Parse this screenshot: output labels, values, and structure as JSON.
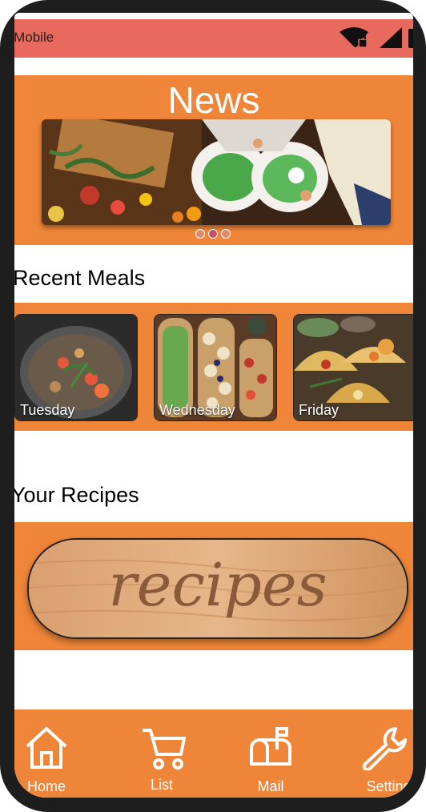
{
  "status_bar": {
    "carrier": "T-Mobile",
    "wifi_icon": "wifi-lock-icon",
    "signal_icon": "signal-icon"
  },
  "news": {
    "title": "News",
    "carousel_image": "salad-preparation-photo",
    "slide_count": 3,
    "active_slide": 2
  },
  "recent_meals": {
    "title": "Recent Meals",
    "items": [
      {
        "label": "Tuesday",
        "image": "stew-pot-photo"
      },
      {
        "label": "Wednesday",
        "image": "avocado-toast-platter-photo"
      },
      {
        "label": "Friday",
        "image": "tacos-photo"
      }
    ]
  },
  "your_recipes": {
    "title": "Your Recipes",
    "board_text": "recipes"
  },
  "bottom_nav": {
    "items": [
      {
        "label": "Home",
        "icon": "home-icon"
      },
      {
        "label": "List",
        "icon": "cart-icon"
      },
      {
        "label": "Mail",
        "icon": "mailbox-icon"
      },
      {
        "label": "Settings",
        "icon": "wrench-icon"
      }
    ]
  },
  "colors": {
    "accent": "#ef8538",
    "status_bar": "#e86a5e",
    "frame": "#1e1e1e"
  }
}
